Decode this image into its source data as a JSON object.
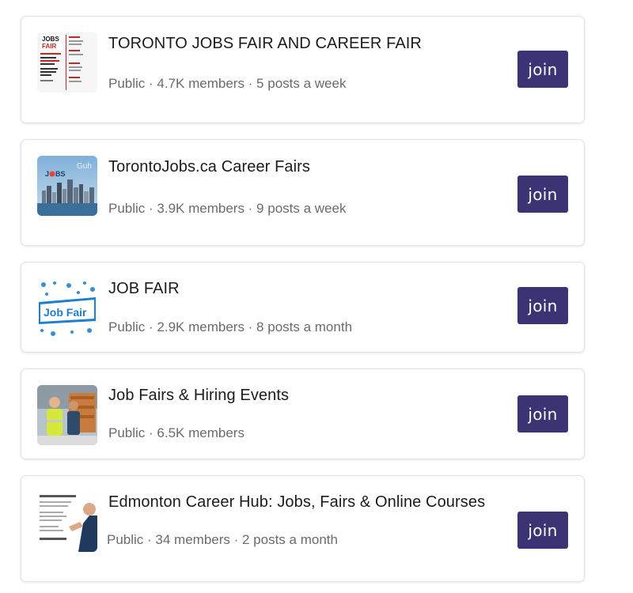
{
  "groups": [
    {
      "title": "TORONTO JOBS FAIR AND CAREER FAIR",
      "meta": "Public · 4.7K members · 5 posts a week",
      "join_label": "join",
      "thumb_icon": "jobs-fair-poster-icon"
    },
    {
      "title": "TorontoJobs.ca Career Fairs",
      "meta": "Public · 3.9K members · 9 posts a week",
      "join_label": "join",
      "thumb_icon": "toronto-skyline-icon"
    },
    {
      "title": "JOB FAIR",
      "meta": "Public · 2.9K members · 8 posts a month",
      "join_label": "join",
      "thumb_icon": "job-fair-sign-icon"
    },
    {
      "title": "Job Fairs & Hiring Events",
      "meta": "Public · 6.5K members",
      "join_label": "join",
      "thumb_icon": "warehouse-workers-icon"
    },
    {
      "title": "Edmonton Career Hub: Jobs, Fairs & Online Courses",
      "meta": "Public · 34 members · 2 posts a month",
      "join_label": "join",
      "thumb_icon": "career-hub-flyer-icon"
    }
  ],
  "colors": {
    "join_button": "#3b3374",
    "title_text": "#1c1c1c",
    "meta_text": "#6b6b6b"
  }
}
